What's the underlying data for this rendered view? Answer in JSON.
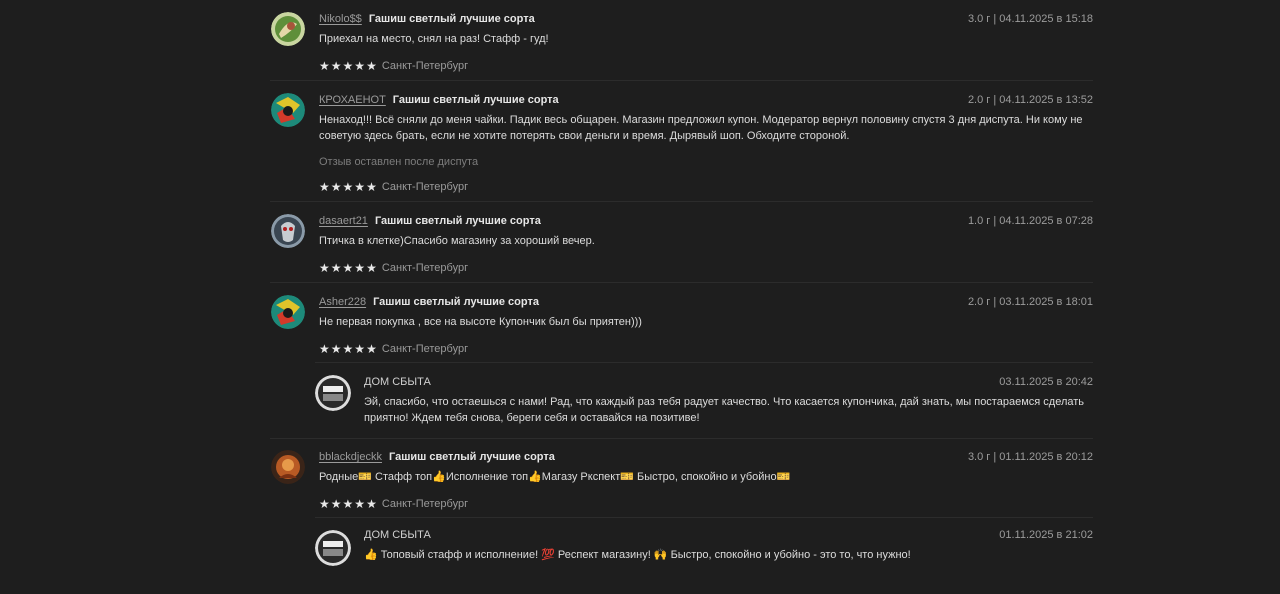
{
  "reviews": [
    {
      "author": "Nikolo$$",
      "product": "Гашиш светлый лучшие сорта",
      "meta": "3.0 г | 04.11.2025 в 15:18",
      "text": "Приехал на место, снял на раз! Стафф - гуд!",
      "city": "Санкт-Петербург",
      "rating": 5,
      "avatar": "avatar-green"
    },
    {
      "author": "КРОХАЕНОТ",
      "product": "Гашиш светлый лучшие сорта",
      "meta": "2.0 г | 04.11.2025 в 13:52",
      "text": "Ненаход!!! Всё сняли до меня чайки. Падик весь общарен. Магазин предложил купон. Модератор вернул половину спустя 3 дня диспута. Ни кому не советую здесь брать, если не хотите потерять свои деньги и время. Дырявый шоп. Обходите стороной.",
      "note": "Отзыв оставлен после диспута",
      "city": "Санкт-Петербург",
      "rating": 5,
      "avatar": "avatar-colorful"
    },
    {
      "author": "dasaert21",
      "product": "Гашиш светлый лучшие сорта",
      "meta": "1.0 г | 04.11.2025 в 07:28",
      "text": "Птичка в клетке)Спасибо магазину за хороший вечер.",
      "city": "Санкт-Петербург",
      "rating": 5,
      "avatar": "avatar-mask"
    },
    {
      "author": "Asher228",
      "product": "Гашиш светлый лучшие сорта",
      "meta": "2.0 г | 03.11.2025 в 18:01",
      "text": "Не первая покупка , все на высоте Купончик был бы приятен)))",
      "city": "Санкт-Петербург",
      "rating": 5,
      "avatar": "avatar-colorful",
      "reply": {
        "shop": "ДОМ СБЫТА",
        "date": "03.11.2025 в 20:42",
        "text": "Эй, спасибо, что остаешься с нами! Рад, что каждый раз тебя радует качество. Что касается купончика, дай знать, мы постараемся сделать приятно! Ждем тебя снова, береги себя и оставайся на позитиве!"
      }
    },
    {
      "author": "bblackdjeckk",
      "product": "Гашиш светлый лучшие сорта",
      "meta": "3.0 г | 01.11.2025 в 20:12",
      "text_parts": [
        "Родные",
        "🎫",
        " Стафф топ",
        "👍",
        "Исполнение топ",
        "👍",
        "Магазу Ркспект",
        "🎫",
        " Быстро, спокойно и убойно",
        "🎫"
      ],
      "city": "Санкт-Петербург",
      "rating": 5,
      "avatar": "avatar-orange",
      "reply": {
        "shop": "ДОМ СБЫТА",
        "date": "01.11.2025 в 21:02",
        "text": "👍 Топовый стафф и исполнение! 💯 Респект магазину! 🙌 Быстро, спокойно и убойно - это то, что нужно!"
      }
    }
  ],
  "colors": {
    "background": "#1e1e1e",
    "divider": "#2c2c2c",
    "text": "#dcdcdc",
    "muted": "#9a9a9a"
  }
}
